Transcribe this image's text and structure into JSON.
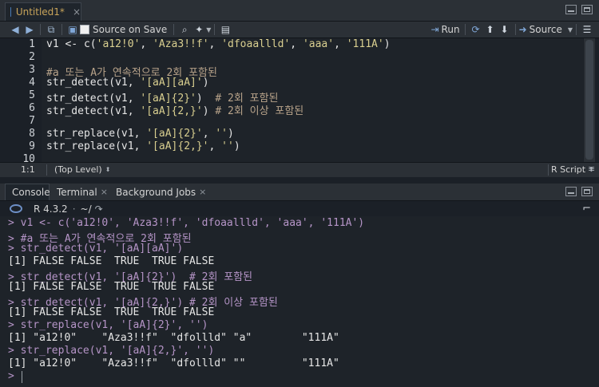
{
  "editor": {
    "tab_label": "Untitled1*",
    "tab_close": "×",
    "source_on_save": "Source on Save",
    "run_label": "Run",
    "source_label": "Source",
    "lines": [
      {
        "n": "1",
        "parts": [
          [
            "v1 <- c(",
            ""
          ],
          [
            "'a12!0'",
            "str"
          ],
          [
            ", ",
            ""
          ],
          [
            "'Aza3!!f'",
            "str"
          ],
          [
            ", ",
            ""
          ],
          [
            "'dfoaallld'",
            "str"
          ],
          [
            ", ",
            ""
          ],
          [
            "'aaa'",
            "str"
          ],
          [
            ", ",
            ""
          ],
          [
            "'111A'",
            "str"
          ],
          [
            ")",
            ""
          ]
        ]
      },
      {
        "n": "2",
        "parts": []
      },
      {
        "n": "3",
        "parts": [
          [
            "#a 또는 A가 연속적으로 2회 포함된",
            "cmt"
          ]
        ]
      },
      {
        "n": "4",
        "parts": [
          [
            "str_detect(v1, ",
            ""
          ],
          [
            "'[aA][aA]'",
            "str"
          ],
          [
            ")",
            ""
          ]
        ]
      },
      {
        "n": "5",
        "parts": [
          [
            "str_detect(v1, ",
            ""
          ],
          [
            "'[aA]{2}'",
            "str"
          ],
          [
            ")  ",
            ""
          ],
          [
            "# 2회 포함된",
            "cmt"
          ]
        ]
      },
      {
        "n": "6",
        "parts": [
          [
            "str_detect(v1, ",
            ""
          ],
          [
            "'[aA]{2,}'",
            "str"
          ],
          [
            ") ",
            ""
          ],
          [
            "# 2회 이상 포함된",
            "cmt"
          ]
        ]
      },
      {
        "n": "7",
        "parts": []
      },
      {
        "n": "8",
        "parts": [
          [
            "str_replace(v1, ",
            ""
          ],
          [
            "'[aA]{2}'",
            "str"
          ],
          [
            ", ",
            ""
          ],
          [
            "''",
            "str"
          ],
          [
            ")",
            ""
          ]
        ]
      },
      {
        "n": "9",
        "parts": [
          [
            "str_replace(v1, ",
            ""
          ],
          [
            "'[aA]{2,}'",
            "str"
          ],
          [
            ", ",
            ""
          ],
          [
            "''",
            "str"
          ],
          [
            ")",
            ""
          ]
        ]
      },
      {
        "n": "10",
        "parts": []
      }
    ],
    "status_position": "1:1",
    "status_scope": "(Top Level)",
    "status_filetype": "R Script"
  },
  "console": {
    "tabs": [
      {
        "label": "Console",
        "close": ""
      },
      {
        "label": "Terminal",
        "close": "×"
      },
      {
        "label": "Background Jobs",
        "close": "×"
      }
    ],
    "r_version": "R 4.3.2",
    "working_dir": "~/",
    "lines": [
      {
        "t": "> v1 <- c('a12!0', 'Aza3!!f', 'dfoaallld', 'aaa', '111A')",
        "k": "in"
      },
      {
        "t": "> #a 또는 A가 연속적으로 2회 포함된",
        "k": "in"
      },
      {
        "t": "> str_detect(v1, '[aA][aA]')",
        "k": "in"
      },
      {
        "t": "[1] FALSE FALSE  TRUE  TRUE FALSE",
        "k": "out"
      },
      {
        "t": "> str_detect(v1, '[aA]{2}')  # 2회 포함된",
        "k": "in"
      },
      {
        "t": "[1] FALSE FALSE  TRUE  TRUE FALSE",
        "k": "out"
      },
      {
        "t": "> str_detect(v1, '[aA]{2,}') # 2회 이상 포함된",
        "k": "in"
      },
      {
        "t": "[1] FALSE FALSE  TRUE  TRUE FALSE",
        "k": "out"
      },
      {
        "t": "> str_replace(v1, '[aA]{2}', '')",
        "k": "in"
      },
      {
        "t": "[1] \"a12!0\"    \"Aza3!!f\"  \"dfollld\" \"a\"        \"111A\"",
        "k": "out"
      },
      {
        "t": "> str_replace(v1, '[aA]{2,}', '')",
        "k": "in"
      },
      {
        "t": "[1] \"a12!0\"    \"Aza3!!f\"  \"dfollld\" \"\"         \"111A\"",
        "k": "out"
      },
      {
        "t": ">",
        "k": "in"
      }
    ]
  }
}
